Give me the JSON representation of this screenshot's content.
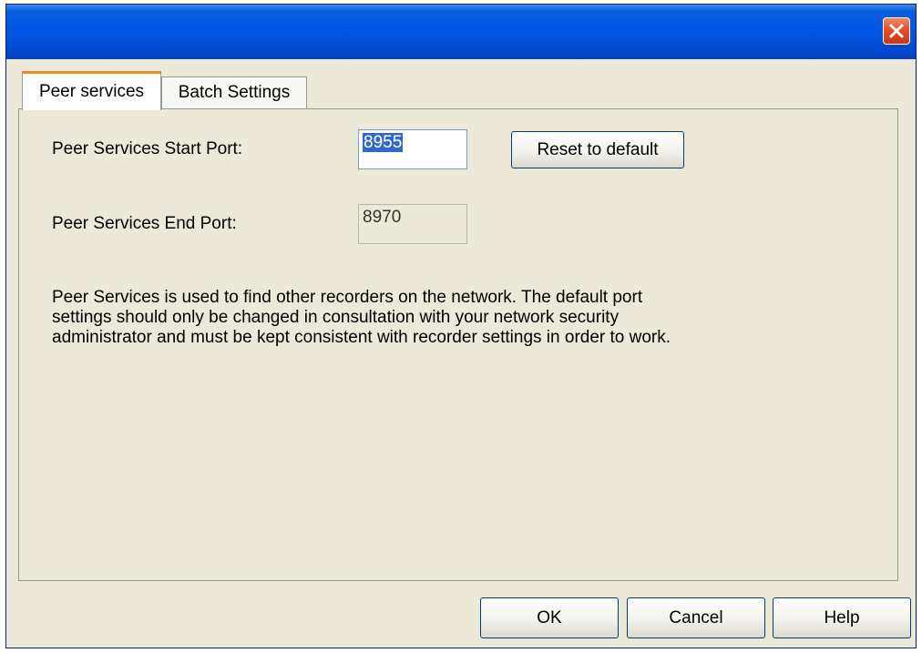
{
  "window": {
    "title": ""
  },
  "tabs": [
    {
      "label": "Peer services",
      "active": true
    },
    {
      "label": "Batch Settings",
      "active": false
    }
  ],
  "peer": {
    "start_label": "Peer Services Start Port:",
    "start_value": "8955",
    "reset_label": "Reset to default",
    "end_label": "Peer Services End Port:",
    "end_value": "8970",
    "description": "Peer Services is used to find other recorders on the network. The default port settings should only be changed in consultation with your network security administrator and must be kept consistent with recorder settings in order to work."
  },
  "buttons": {
    "ok": "OK",
    "cancel": "Cancel",
    "help": "Help"
  },
  "colors": {
    "title_bar": "#0054e3",
    "close_button": "#e2502a",
    "active_tab_accent": "#e68b2c",
    "dialog_face": "#ece9d8"
  },
  "icons": {
    "close": "close-icon"
  }
}
